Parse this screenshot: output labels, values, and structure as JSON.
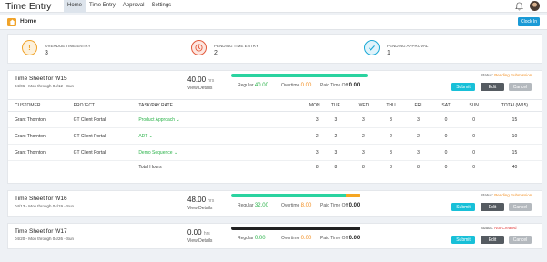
{
  "app": {
    "title": "Time Entry"
  },
  "nav": {
    "items": [
      "Home",
      "Time Entry",
      "Approval",
      "Settings"
    ],
    "active": "Home"
  },
  "subheader": {
    "title": "Home",
    "clock_in": "Clock In"
  },
  "summary": [
    {
      "label": "OVERDUE TIME ENTRY",
      "count": "3",
      "icon": "exclamation-icon",
      "color": "#f0a32a"
    },
    {
      "label": "PENDING TIME ENTRY",
      "count": "2",
      "icon": "clock-icon",
      "color": "#e25a3c"
    },
    {
      "label": "PENDING APPROVAL",
      "count": "1",
      "icon": "check-icon",
      "color": "#1aa9d6"
    }
  ],
  "labels": {
    "hrs": "hrs",
    "view_details": "View Details",
    "regular": "Regular",
    "overtime": "Overtime",
    "paid_time_off": "Paid Time Off",
    "status": "Status:",
    "submit": "Submit",
    "edit": "Edit",
    "cancel": "Cancel"
  },
  "table": {
    "headers": [
      "CUSTOMER",
      "PROJECT",
      "TASK/PAY RATE",
      "MON",
      "TUE",
      "WED",
      "THU",
      "FRI",
      "SAT",
      "SUN",
      "TOTAL(W15)"
    ],
    "rows": [
      {
        "customer": "Grant Thornton",
        "project": "GT Client Portal",
        "task": "Product Approach",
        "days": [
          "3",
          "3",
          "3",
          "3",
          "3",
          "0",
          "0"
        ],
        "total": "15"
      },
      {
        "customer": "Grant Thornton",
        "project": "GT Client Portal",
        "task": "ADT",
        "days": [
          "2",
          "2",
          "2",
          "2",
          "2",
          "0",
          "0"
        ],
        "total": "10"
      },
      {
        "customer": "Grant Thornton",
        "project": "GT Client Portal",
        "task": "Demo Sequence",
        "days": [
          "3",
          "3",
          "3",
          "3",
          "3",
          "0",
          "0"
        ],
        "total": "15"
      }
    ],
    "total_row": {
      "label": "Total Hours",
      "days": [
        "8",
        "8",
        "8",
        "8",
        "8",
        "0",
        "0"
      ],
      "total": "40"
    }
  },
  "timesheets": [
    {
      "title": "Time Sheet for W15",
      "dates": "04/06 - Mon through 04/12 - Sun",
      "hours": "40.00",
      "regular": "40.00",
      "overtime": "0.00",
      "pto": "0.00",
      "status": "Pending Submission",
      "status_color": "#f28c1c",
      "progress": {
        "regular": 1.0,
        "overtime": 0.0
      },
      "bar_colors": [
        "#2bd3a0",
        "#f5a623"
      ]
    },
    {
      "title": "Time Sheet for W16",
      "dates": "04/13 - Mon through 04/19 - Sun",
      "hours": "48.00",
      "regular": "32.00",
      "overtime": "8.00",
      "pto": "0.00",
      "status": "Pending Submission",
      "status_color": "#f28c1c",
      "progress": {
        "regular": 0.89,
        "overtime": 0.11
      },
      "bar_colors": [
        "#2bd3a0",
        "#f5a623"
      ]
    },
    {
      "title": "Time Sheet for W17",
      "dates": "04/20 - Mon through 04/26 - Sun",
      "hours": "0.00",
      "regular": "0.00",
      "overtime": "0.00",
      "pto": "0.00",
      "status": "Not Created",
      "status_color": "#e23c3c",
      "progress": {
        "regular": 0.0,
        "overtime": 0.0
      },
      "bar_colors": [
        "#222222",
        "#222222"
      ]
    }
  ]
}
